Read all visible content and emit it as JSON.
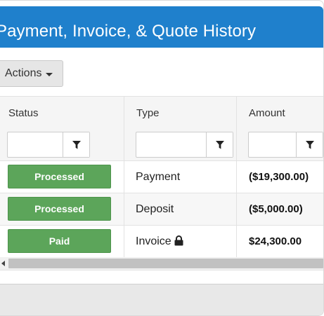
{
  "header": {
    "title": "Payment, Invoice, & Quote History"
  },
  "toolbar": {
    "actions_label": "Actions"
  },
  "grid": {
    "columns": [
      {
        "label": "Status"
      },
      {
        "label": "Type"
      },
      {
        "label": "Amount"
      }
    ],
    "filters": [
      {
        "value": ""
      },
      {
        "value": ""
      },
      {
        "value": ""
      }
    ],
    "rows": [
      {
        "status": "Processed",
        "type": "Payment",
        "amount": "($19,300.00)",
        "locked": false
      },
      {
        "status": "Processed",
        "type": "Deposit",
        "amount": "($5,000.00)",
        "locked": false
      },
      {
        "status": "Paid",
        "type": "Invoice",
        "amount": "$24,300.00",
        "locked": true
      }
    ]
  },
  "colors": {
    "header_bg": "#1f80cc",
    "status_badge": "#5ca55a"
  },
  "icons": {
    "filter": "filter-icon",
    "lock": "lock-icon",
    "scroll_left": "chevron-left-icon",
    "caret": "caret-down-icon"
  }
}
